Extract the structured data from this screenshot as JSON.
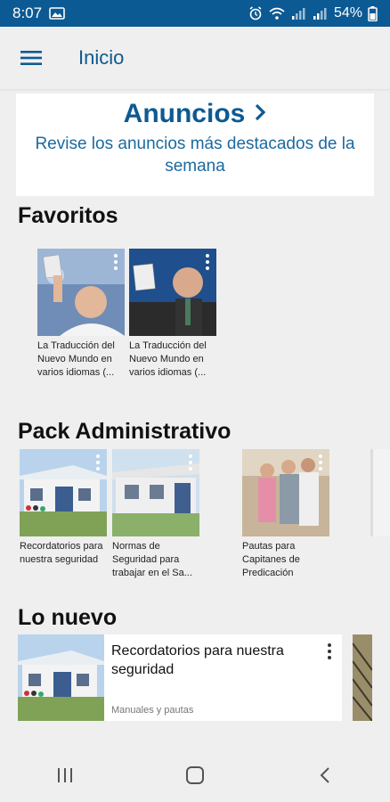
{
  "status": {
    "time": "8:07",
    "battery": "54%"
  },
  "appbar": {
    "title": "Inicio"
  },
  "announcement": {
    "title": "Anuncios",
    "subtitle": "Revise los anuncios más destacados de la semana"
  },
  "favoritos": {
    "title": "Favoritos",
    "items": [
      {
        "caption": "La Traducción del Nuevo Mundo en varios idiomas (..."
      },
      {
        "caption": "La Traducción del Nuevo Mundo en varios idiomas (..."
      }
    ]
  },
  "pack": {
    "title": "Pack Administrativo",
    "items": [
      {
        "caption": "Recordatorios para nuestra seguridad"
      },
      {
        "caption": "Normas de Seguridad para trabajar en el Sa..."
      },
      {
        "caption": "Pautas para Capitanes de Predicación"
      }
    ]
  },
  "nuevo": {
    "title": "Lo nuevo",
    "item": {
      "title": "Recordatorios para nuestra seguridad",
      "category": "Manuales y pautas"
    }
  },
  "colors": {
    "statusbar": "#0c5a93",
    "accent": "#0d5a92",
    "background": "#efefef"
  }
}
